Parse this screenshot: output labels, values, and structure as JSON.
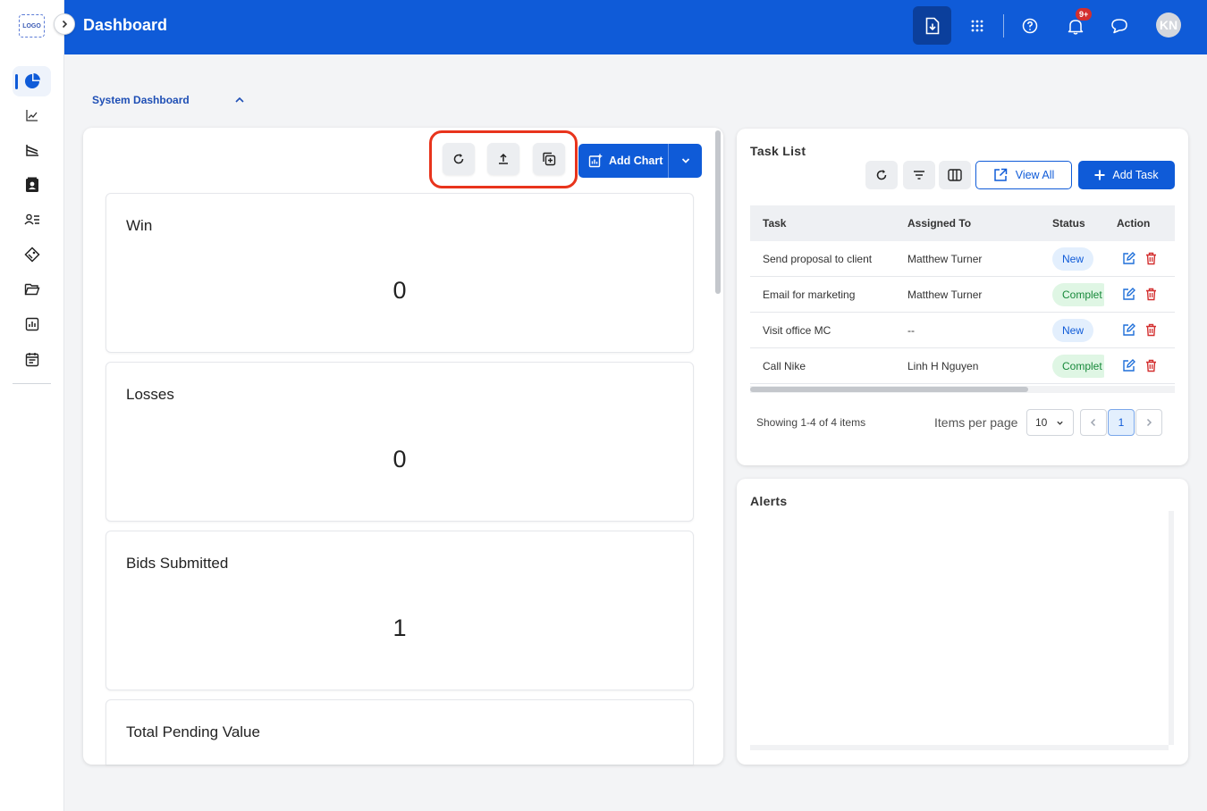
{
  "brand": {
    "logo_text": "LOGO"
  },
  "sidebar": {
    "items": [
      {
        "name": "dashboard",
        "icon": "pie-chart-icon",
        "active": true
      },
      {
        "name": "analytics",
        "icon": "trending-line-icon"
      },
      {
        "name": "reports",
        "icon": "chart-axes-icon"
      },
      {
        "name": "contacts",
        "icon": "contact-card-icon"
      },
      {
        "name": "users",
        "icon": "user-list-icon"
      },
      {
        "name": "deals",
        "icon": "tag-icon"
      },
      {
        "name": "files",
        "icon": "folder-open-icon"
      },
      {
        "name": "statistics",
        "icon": "bar-chart-icon"
      },
      {
        "name": "calendar",
        "icon": "calendar-icon"
      }
    ]
  },
  "header": {
    "title": "Dashboard",
    "notification_count": "9+",
    "avatar_initials": "KN",
    "colors": {
      "primary": "#0f5bd8",
      "download_bg": "#0b3f9c",
      "badge": "#d32f2f"
    }
  },
  "section": {
    "title": "System Dashboard"
  },
  "dashboard": {
    "add_chart_label": "Add Chart",
    "tools": [
      "refresh-icon",
      "export-upload-icon",
      "duplicate-icon"
    ],
    "cards": [
      {
        "label": "Win",
        "value": "0"
      },
      {
        "label": "Losses",
        "value": "0"
      },
      {
        "label": "Bids Submitted",
        "value": "1"
      },
      {
        "label": "Total Pending Value",
        "value": ""
      }
    ]
  },
  "tasks": {
    "title": "Task List",
    "view_all_label": "View All",
    "add_task_label": "Add Task",
    "columns": [
      "Task",
      "Assigned To",
      "Status",
      "Action"
    ],
    "rows": [
      {
        "task": "Send proposal to client",
        "assigned": "Matthew Turner",
        "status": "New",
        "status_type": "new"
      },
      {
        "task": "Email for marketing",
        "assigned": "Matthew Turner",
        "status": "Complet",
        "status_type": "complete"
      },
      {
        "task": "Visit office MC",
        "assigned": "--",
        "status": "New",
        "status_type": "new"
      },
      {
        "task": "Call Nike",
        "assigned": "Linh H Nguyen",
        "status": "Complet",
        "status_type": "complete"
      }
    ],
    "showing_text": "Showing 1-4 of 4 items",
    "items_per_page_label": "Items per page",
    "items_per_page_value": "10",
    "current_page": "1"
  },
  "alerts": {
    "title": "Alerts"
  }
}
